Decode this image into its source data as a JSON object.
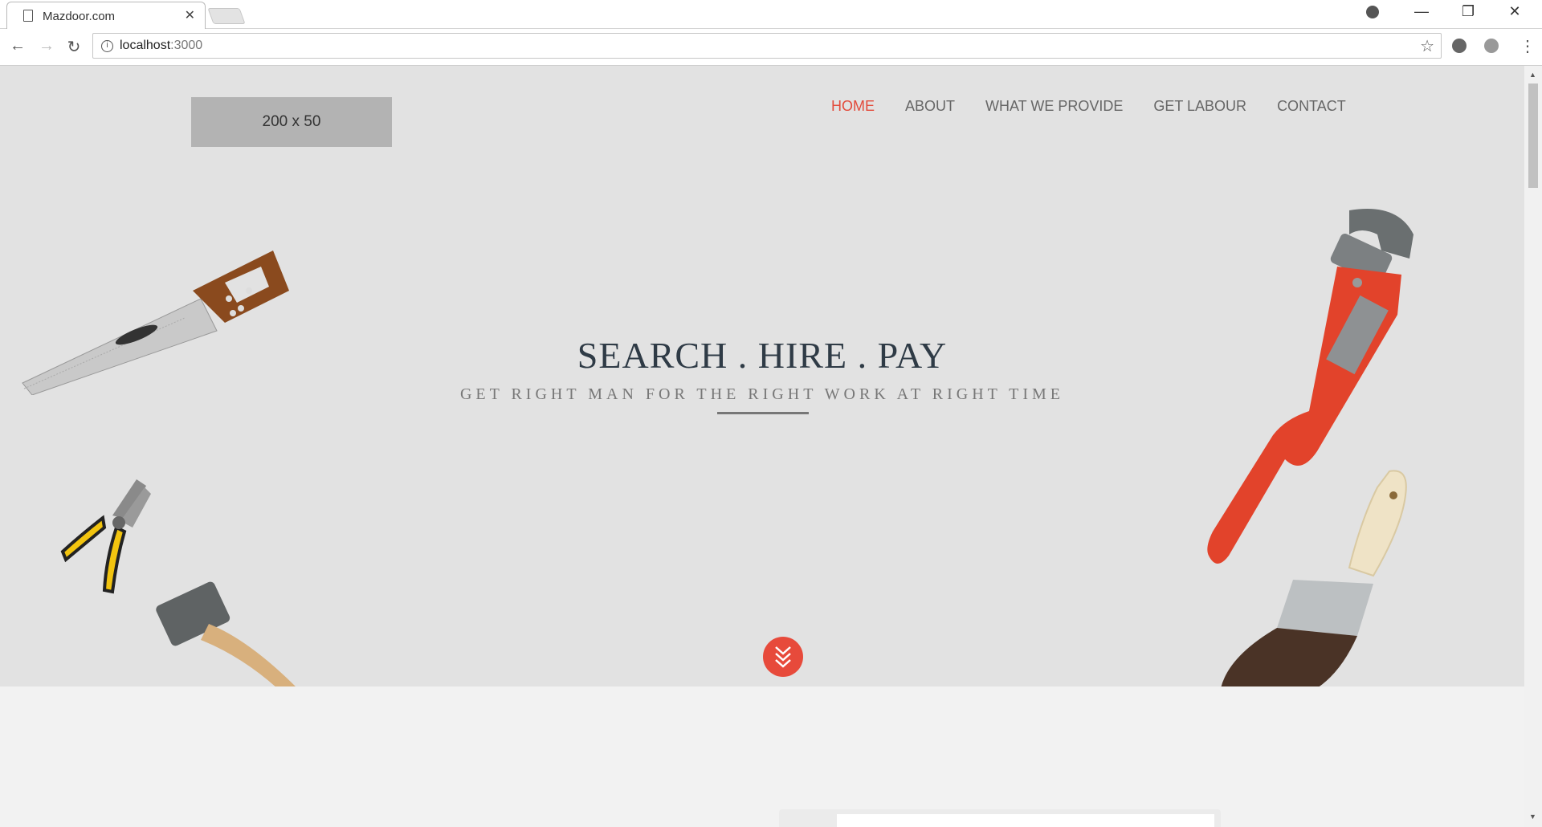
{
  "browser": {
    "tab_title": "Mazdoor.com",
    "tab_close": "✕",
    "url_host": "localhost",
    "url_port": ":3000",
    "window_controls": {
      "minimize": "—",
      "maximize": "❐",
      "close": "✕"
    },
    "nav": {
      "back": "←",
      "forward": "→",
      "reload": "↻"
    },
    "star": "☆",
    "menu": "⋮"
  },
  "site": {
    "logo_text": "200 x 50",
    "nav_items": [
      {
        "label": "HOME",
        "active": true
      },
      {
        "label": "ABOUT",
        "active": false
      },
      {
        "label": "WHAT WE PROVIDE",
        "active": false
      },
      {
        "label": "GET LABOUR",
        "active": false
      },
      {
        "label": "CONTACT",
        "active": false
      }
    ],
    "headline": "SEARCH . HIRE . PAY",
    "subline": "GET RIGHT MAN FOR THE RIGHT WORK AT RIGHT TIME"
  },
  "icons": {
    "tools": [
      "saw-icon",
      "pipe-wrench-icon",
      "pliers-icon",
      "hammer-icon",
      "paint-brush-icon"
    ],
    "scroll_down": "chevrons-down-icon"
  },
  "colors": {
    "accent": "#e74a3b",
    "hero_bg": "#e2e2e2",
    "headline": "#2f3b46"
  }
}
